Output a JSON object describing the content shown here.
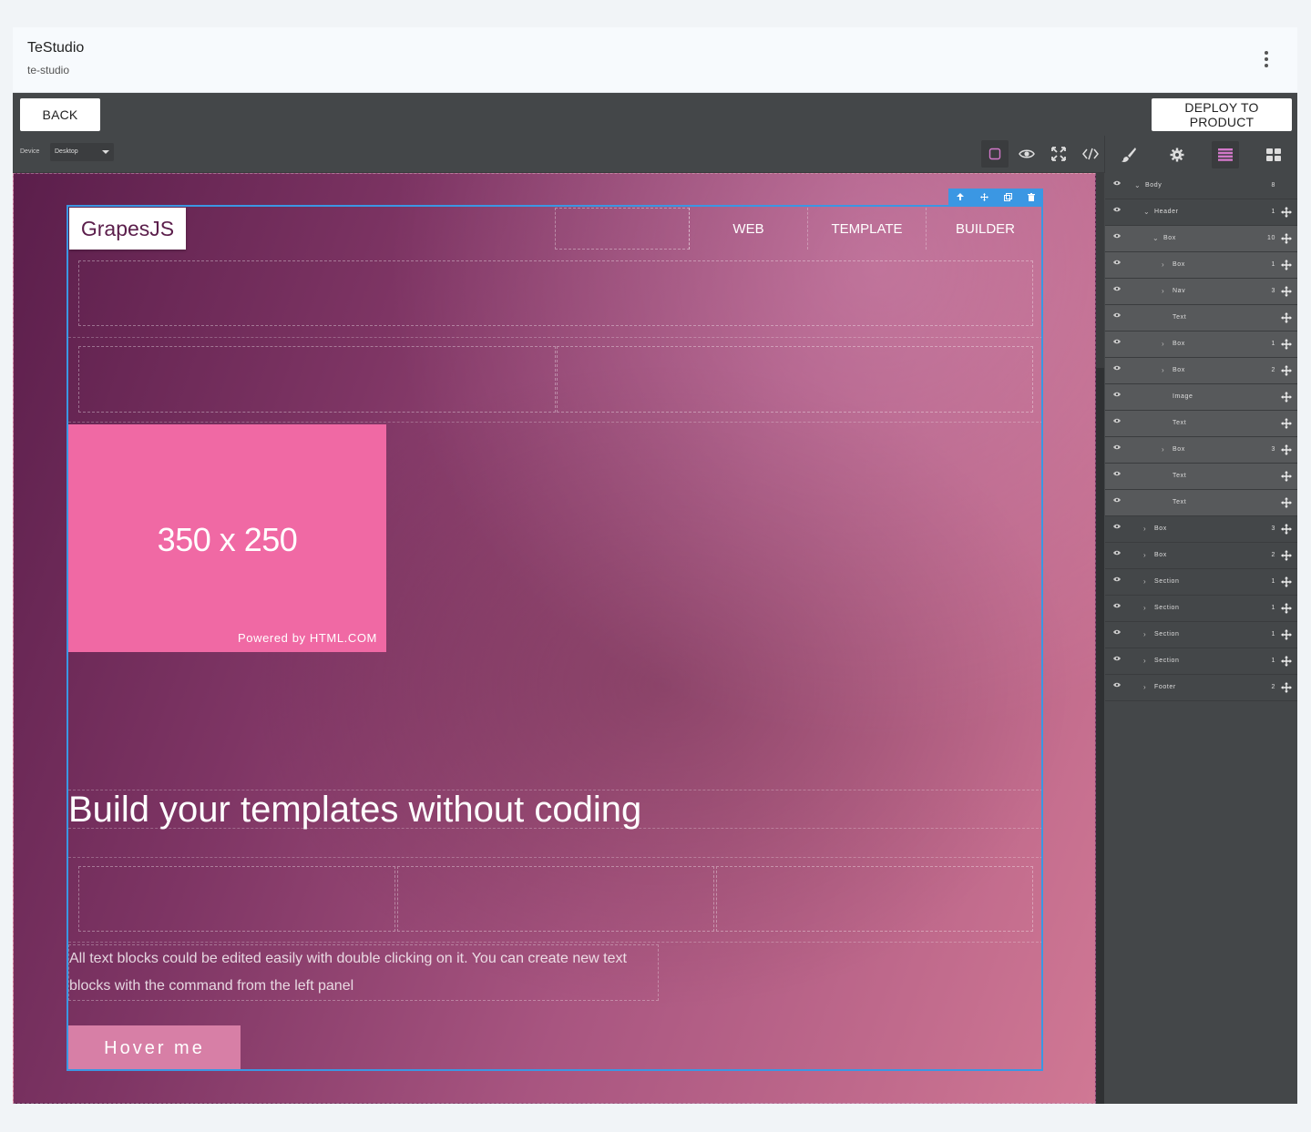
{
  "app": {
    "title": "TeStudio",
    "slug": "te-studio"
  },
  "actions": {
    "back_label": "BACK",
    "deploy_label": "DEPLOY TO PRODUCT"
  },
  "toolbar": {
    "device_label": "Device",
    "device_value": "Desktop",
    "tools": [
      "sw-visibility-icon",
      "preview-eye-icon",
      "fullscreen-icon",
      "code-icon"
    ],
    "active_tool": "sw-visibility-icon"
  },
  "panel_tabs": {
    "tabs": [
      "style-manager-brush-icon",
      "settings-gear-icon",
      "layer-manager-icon",
      "blocks-grid-icon"
    ],
    "active": "layer-manager-icon"
  },
  "canvas": {
    "logo": "GrapesJS",
    "nav": [
      "WEB",
      "TEMPLATE",
      "BUILDER"
    ],
    "placeholder_dim": "350 x 250",
    "placeholder_powered": "Powered by HTML.COM",
    "headline": "Build your templates without coding",
    "paragraph": "All text blocks could be edited easily with double clicking on it. You can create new text blocks with the command from the left panel",
    "button": "Hover me"
  },
  "layers": [
    {
      "name": "Body",
      "count": "8",
      "depth": 0,
      "expanded": true,
      "selected": false,
      "move": false
    },
    {
      "name": "Header",
      "count": "1",
      "depth": 1,
      "expanded": true,
      "selected": false,
      "move": true
    },
    {
      "name": "Box",
      "count": "10",
      "depth": 2,
      "expanded": true,
      "selected": true,
      "move": true
    },
    {
      "name": "Box",
      "count": "1",
      "depth": 3,
      "expanded": false,
      "selected": true,
      "move": true
    },
    {
      "name": "Nav",
      "count": "3",
      "depth": 3,
      "expanded": false,
      "selected": true,
      "move": true
    },
    {
      "name": "Text",
      "count": "",
      "depth": 3,
      "leaf": true,
      "selected": true,
      "move": true
    },
    {
      "name": "Box",
      "count": "1",
      "depth": 3,
      "expanded": false,
      "selected": true,
      "move": true
    },
    {
      "name": "Box",
      "count": "2",
      "depth": 3,
      "expanded": false,
      "selected": true,
      "move": true
    },
    {
      "name": "Image",
      "count": "",
      "depth": 3,
      "leaf": true,
      "selected": true,
      "move": true
    },
    {
      "name": "Text",
      "count": "",
      "depth": 3,
      "leaf": true,
      "selected": true,
      "move": true
    },
    {
      "name": "Box",
      "count": "3",
      "depth": 3,
      "expanded": false,
      "selected": true,
      "move": true
    },
    {
      "name": "Text",
      "count": "",
      "depth": 3,
      "leaf": true,
      "selected": true,
      "move": true
    },
    {
      "name": "Text",
      "count": "",
      "depth": 3,
      "leaf": true,
      "selected": true,
      "move": true
    },
    {
      "name": "Box",
      "count": "3",
      "depth": 1,
      "expanded": false,
      "selected": false,
      "move": true
    },
    {
      "name": "Box",
      "count": "2",
      "depth": 1,
      "expanded": false,
      "selected": false,
      "move": true
    },
    {
      "name": "Section",
      "count": "1",
      "depth": 1,
      "expanded": false,
      "selected": false,
      "move": true
    },
    {
      "name": "Section",
      "count": "1",
      "depth": 1,
      "expanded": false,
      "selected": false,
      "move": true
    },
    {
      "name": "Section",
      "count": "1",
      "depth": 1,
      "expanded": false,
      "selected": false,
      "move": true
    },
    {
      "name": "Section",
      "count": "1",
      "depth": 1,
      "expanded": false,
      "selected": false,
      "move": true
    },
    {
      "name": "Footer",
      "count": "2",
      "depth": 1,
      "expanded": false,
      "selected": false,
      "move": true
    }
  ],
  "colors": {
    "accent_pink": "#d278c9",
    "selection_blue": "#3b97e3",
    "panel_bg": "#444749",
    "placeholder_pink": "#f069a4"
  }
}
